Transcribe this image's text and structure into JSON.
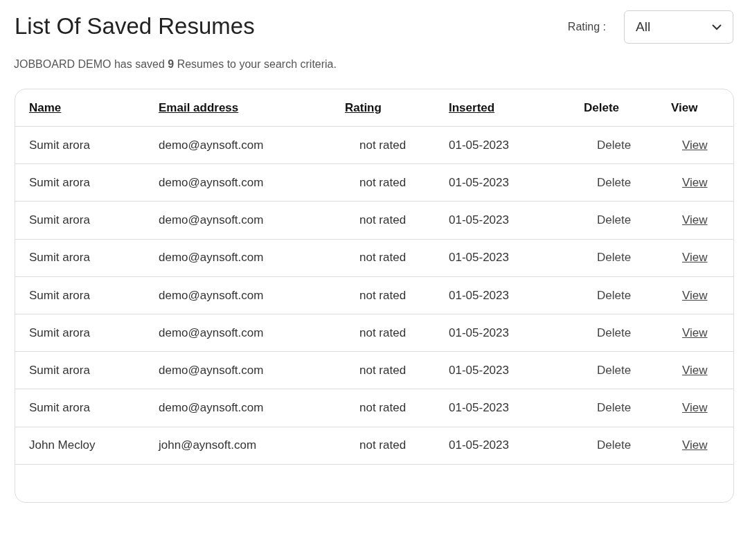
{
  "title": "List Of Saved Resumes",
  "rating_filter": {
    "label": "Rating :",
    "value": "All"
  },
  "summary": "JOBBOARD DEMO has saved **9** Resumes to your search criteria.",
  "table": {
    "columns": [
      {
        "label": "Name",
        "sortable": true
      },
      {
        "label": "Email address",
        "sortable": true
      },
      {
        "label": "Rating",
        "sortable": true
      },
      {
        "label": "Inserted",
        "sortable": true
      },
      {
        "label": "Delete",
        "sortable": false
      },
      {
        "label": "View",
        "sortable": false
      }
    ],
    "rows": [
      {
        "name": "Sumit arora",
        "email": "demo@aynsoft.com",
        "rating": "not rated",
        "inserted": "01-05-2023",
        "delete": "Delete",
        "view": "View"
      },
      {
        "name": "Sumit arora",
        "email": "demo@aynsoft.com",
        "rating": "not rated",
        "inserted": "01-05-2023",
        "delete": "Delete",
        "view": "View"
      },
      {
        "name": "Sumit arora",
        "email": "demo@aynsoft.com",
        "rating": "not rated",
        "inserted": "01-05-2023",
        "delete": "Delete",
        "view": "View"
      },
      {
        "name": "Sumit arora",
        "email": "demo@aynsoft.com",
        "rating": "not rated",
        "inserted": "01-05-2023",
        "delete": "Delete",
        "view": "View"
      },
      {
        "name": "Sumit arora",
        "email": "demo@aynsoft.com",
        "rating": "not rated",
        "inserted": "01-05-2023",
        "delete": "Delete",
        "view": "View"
      },
      {
        "name": "Sumit arora",
        "email": "demo@aynsoft.com",
        "rating": "not rated",
        "inserted": "01-05-2023",
        "delete": "Delete",
        "view": "View"
      },
      {
        "name": "Sumit arora",
        "email": "demo@aynsoft.com",
        "rating": "not rated",
        "inserted": "01-05-2023",
        "delete": "Delete",
        "view": "View"
      },
      {
        "name": "Sumit arora",
        "email": "demo@aynsoft.com",
        "rating": "not rated",
        "inserted": "01-05-2023",
        "delete": "Delete",
        "view": "View"
      },
      {
        "name": "John Mecloy",
        "email": "john@aynsoft.com",
        "rating": "not rated",
        "inserted": "01-05-2023",
        "delete": "Delete",
        "view": "View"
      }
    ]
  }
}
